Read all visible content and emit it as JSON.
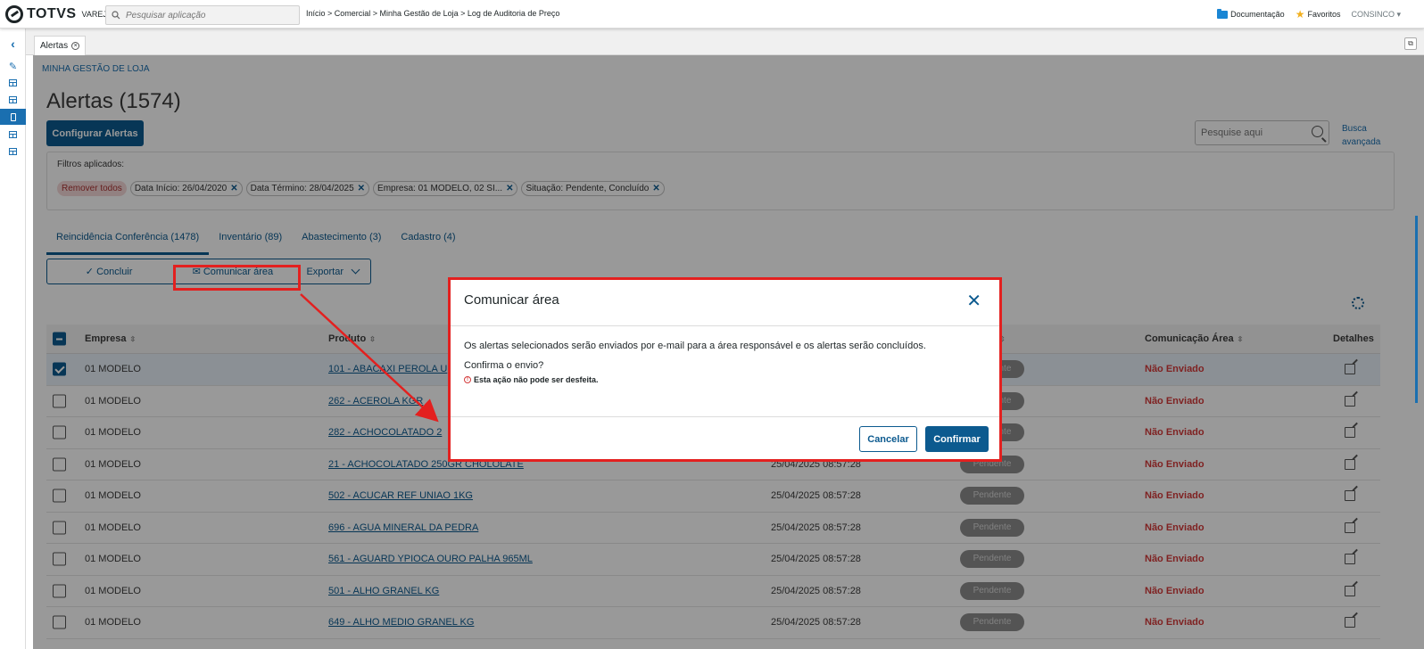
{
  "app": {
    "brand": "TOTVS",
    "brand_sub": "VAREJO",
    "search_placeholder": "Pesquisar aplicação",
    "breadcrumb": "Início > Comercial > Minha Gestão de Loja > Log de Auditoria de Preço",
    "documentation": "Documentação",
    "favorites": "Favoritos",
    "user": "CONSINCO ▾"
  },
  "tab": {
    "label": "Alertas"
  },
  "page": {
    "section": "MINHA GESTÃO DE LOJA",
    "title": "Alertas (1574)",
    "config_button": "Configurar Alertas",
    "search_placeholder": "Pesquise aqui",
    "advanced_search": "Busca avançada"
  },
  "filters": {
    "label": "Filtros aplicados:",
    "remove_all": "Remover todos",
    "chips": [
      "Data Início: 26/04/2020",
      "Data Término: 28/04/2025",
      "Empresa: 01 MODELO, 02 SI...",
      "Situação: Pendente, Concluído"
    ]
  },
  "tabs": [
    "Reincidência Conferência (1478)",
    "Inventário (89)",
    "Abastecimento (3)",
    "Cadastro (4)"
  ],
  "actions": {
    "concluir": "✓ Concluir",
    "comunicar": "✉ Comunicar área",
    "exportar": "Exportar"
  },
  "table": {
    "headers": {
      "empresa": "Empresa",
      "produto": "Produto",
      "situacao": "ão",
      "comunicacao": "Comunicação Área",
      "detalhes": "Detalhes"
    },
    "rows": [
      {
        "empresa": "01 MODELO",
        "produto": "101 - ABACAXI PEROLA U",
        "data": "",
        "situacao": "Pendente",
        "comunicacao": "Não Enviado",
        "checked": true
      },
      {
        "empresa": "01 MODELO",
        "produto": "262 - ACEROLA KGR",
        "data": "",
        "situacao": "Pendente",
        "comunicacao": "Não Enviado",
        "checked": false
      },
      {
        "empresa": "01 MODELO",
        "produto": "282 - ACHOCOLATADO 2",
        "data": "",
        "situacao": "Pendente",
        "comunicacao": "Não Enviado",
        "checked": false
      },
      {
        "empresa": "01 MODELO",
        "produto": "21 - ACHOCOLATADO 250GR CHOLOLATE",
        "data": "25/04/2025 08:57:28",
        "situacao": "Pendente",
        "comunicacao": "Não Enviado",
        "checked": false
      },
      {
        "empresa": "01 MODELO",
        "produto": "502 - ACUCAR REF UNIAO 1KG",
        "data": "25/04/2025 08:57:28",
        "situacao": "Pendente",
        "comunicacao": "Não Enviado",
        "checked": false
      },
      {
        "empresa": "01 MODELO",
        "produto": "696 - AGUA MINERAL DA PEDRA",
        "data": "25/04/2025 08:57:28",
        "situacao": "Pendente",
        "comunicacao": "Não Enviado",
        "checked": false
      },
      {
        "empresa": "01 MODELO",
        "produto": "561 - AGUARD YPIOCA OURO PALHA 965ML",
        "data": "25/04/2025 08:57:28",
        "situacao": "Pendente",
        "comunicacao": "Não Enviado",
        "checked": false
      },
      {
        "empresa": "01 MODELO",
        "produto": "501 - ALHO GRANEL KG",
        "data": "25/04/2025 08:57:28",
        "situacao": "Pendente",
        "comunicacao": "Não Enviado",
        "checked": false
      },
      {
        "empresa": "01 MODELO",
        "produto": "649 - ALHO MEDIO GRANEL KG",
        "data": "25/04/2025 08:57:28",
        "situacao": "Pendente",
        "comunicacao": "Não Enviado",
        "checked": false
      }
    ]
  },
  "modal": {
    "title": "Comunicar área",
    "message": "Os alertas selecionados serão enviados por e-mail para a área responsável e os alertas serão concluídos.",
    "question": "Confirma o envio?",
    "warning": "Esta ação não pode ser desfeita.",
    "cancel": "Cancelar",
    "confirm": "Confirmar"
  },
  "colors": {
    "primary": "#0c5a8f",
    "annotation_red": "#e3201f",
    "status_red": "#d43a3a"
  }
}
